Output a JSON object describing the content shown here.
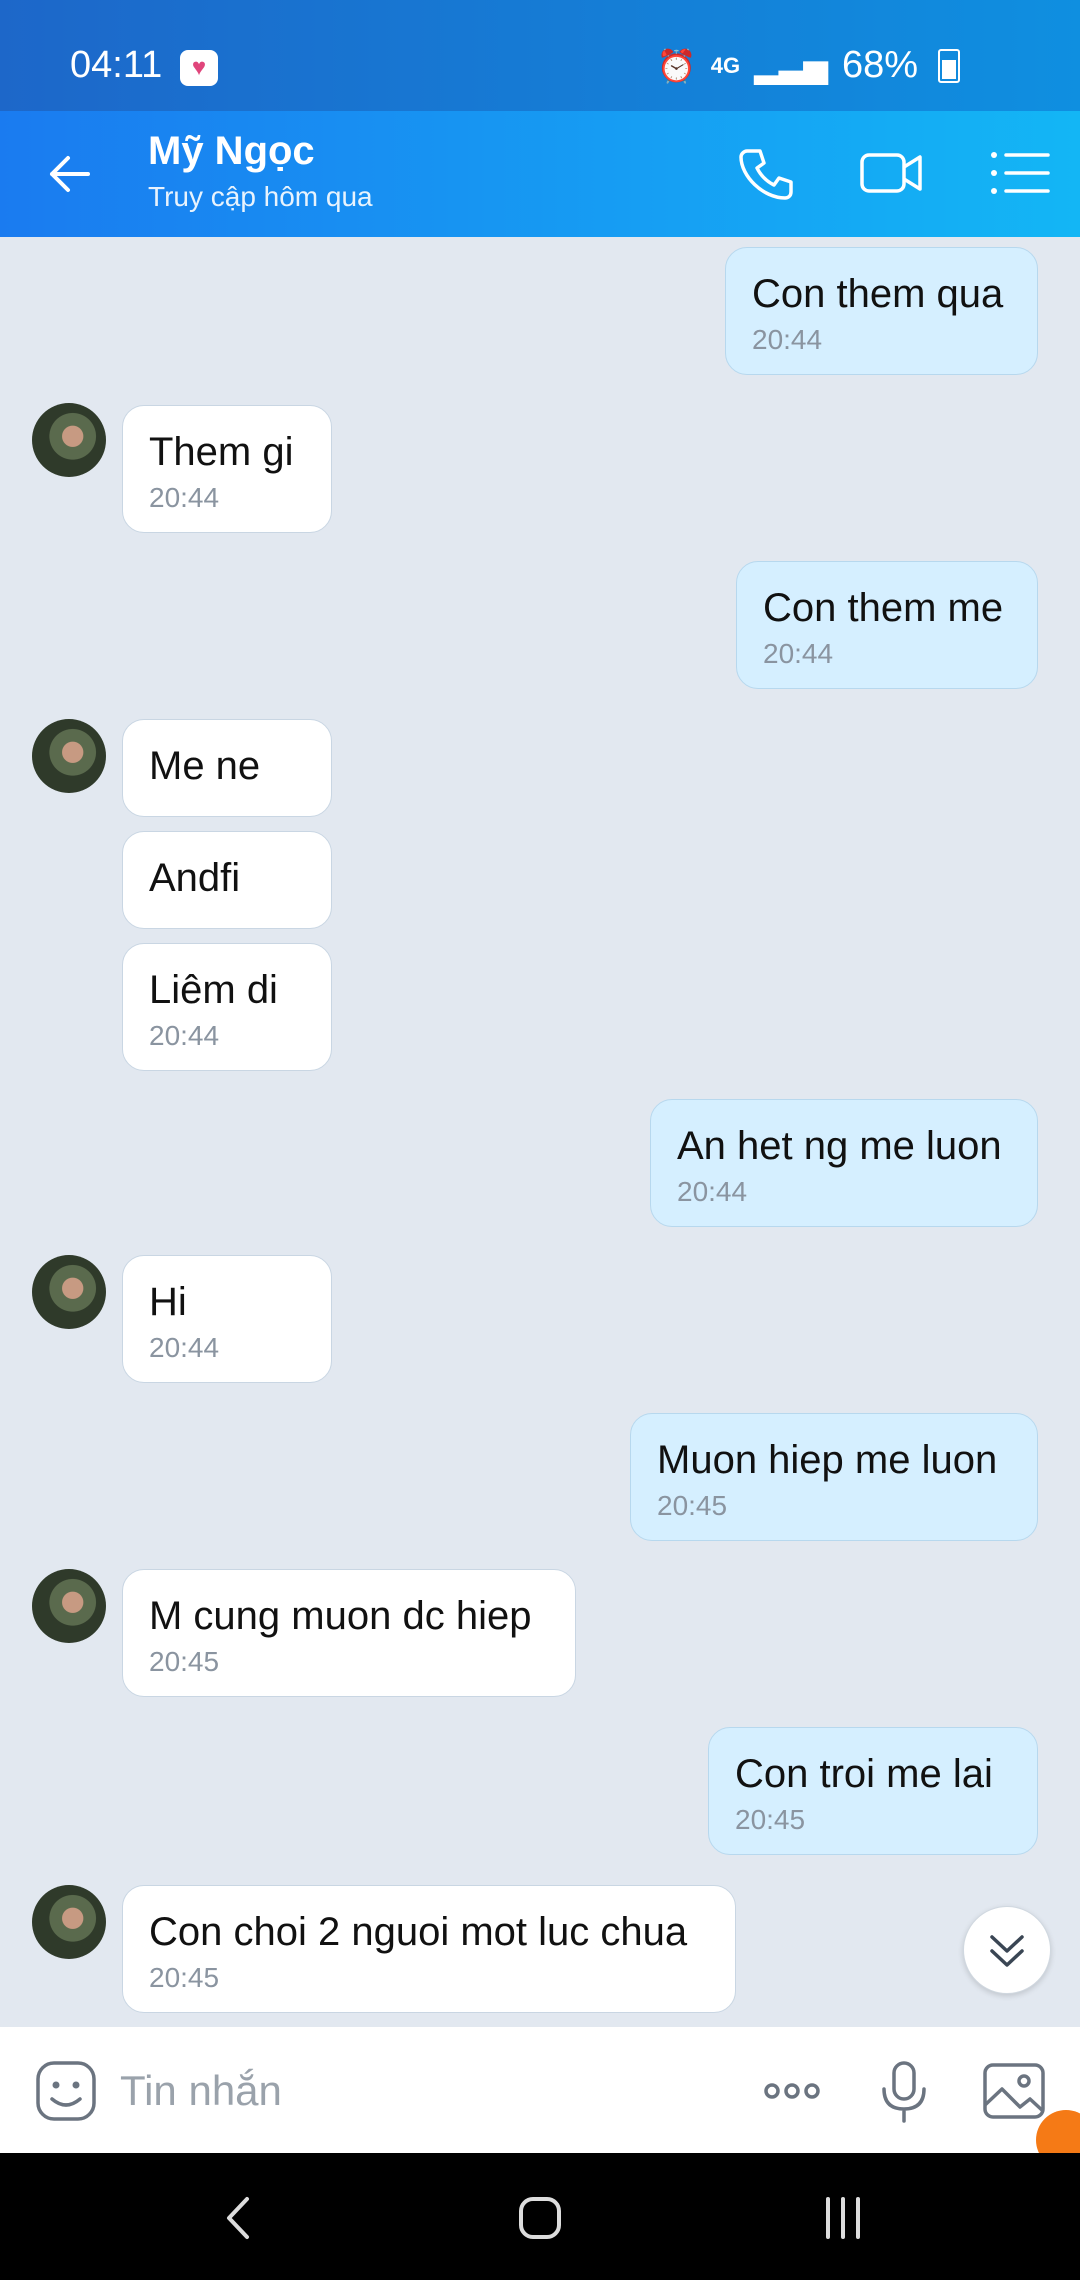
{
  "status_bar": {
    "time": "04:11",
    "network": "4G",
    "battery": "68%"
  },
  "header": {
    "name": "Mỹ Ngọc",
    "status": "Truy cập hôm qua"
  },
  "messages": [
    {
      "side": "out",
      "text": "Con them qua",
      "time": "20:44"
    },
    {
      "side": "in",
      "text": "Them gi",
      "time": "20:44"
    },
    {
      "side": "out",
      "text": "Con them me",
      "time": "20:44"
    },
    {
      "side": "in",
      "text": "Me ne",
      "time": ""
    },
    {
      "side": "in",
      "text": "Andfi",
      "time": ""
    },
    {
      "side": "in",
      "text": "Liêm di",
      "time": "20:44"
    },
    {
      "side": "out",
      "text": "An het ng me luon",
      "time": "20:44"
    },
    {
      "side": "in",
      "text": "Hi",
      "time": "20:44"
    },
    {
      "side": "out",
      "text": "Muon hiep me luon",
      "time": "20:45"
    },
    {
      "side": "in",
      "text": "M cung muon dc hiep",
      "time": "20:45"
    },
    {
      "side": "out",
      "text": "Con troi me lai",
      "time": "20:45"
    },
    {
      "side": "in",
      "text": "Con choi 2 nguoi mot luc chua",
      "time": "20:45"
    }
  ],
  "composer": {
    "placeholder": "Tin nhắn"
  },
  "icons": {
    "back": "arrow-left-icon",
    "call": "phone-icon",
    "video": "video-camera-icon",
    "menu": "list-icon",
    "emoji": "emoji-icon",
    "more": "more-dots-icon",
    "mic": "microphone-icon",
    "gallery": "image-icon",
    "scroll": "chevron-double-down-icon"
  },
  "colors": {
    "header_start": "#1a7bf0",
    "header_end": "#13b6f5",
    "outgoing_bubble": "#d5efff",
    "incoming_bubble": "#ffffff",
    "chat_background": "#e2e8f0"
  }
}
